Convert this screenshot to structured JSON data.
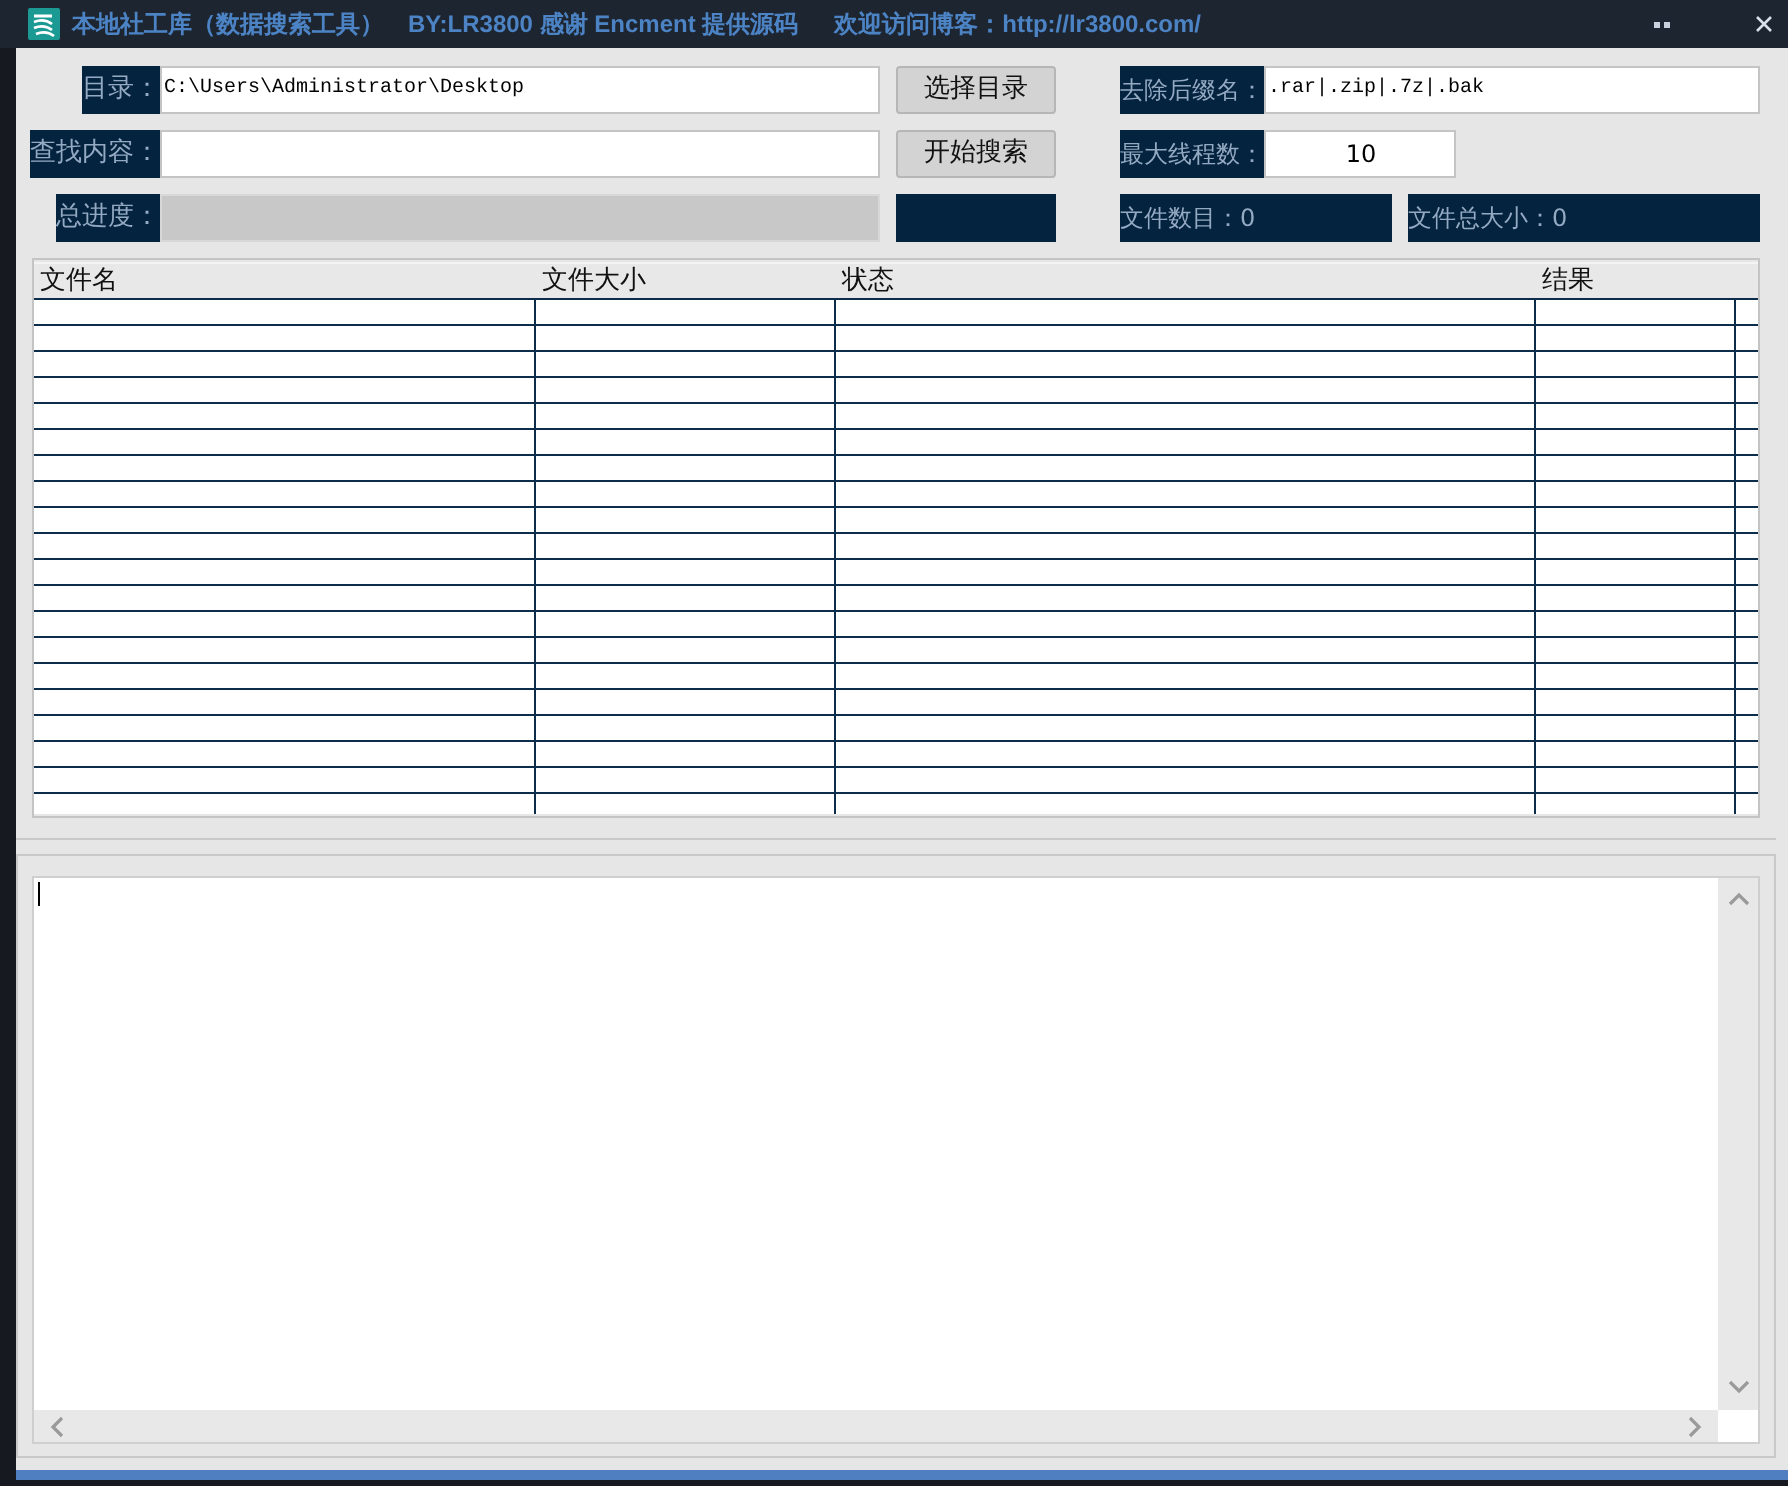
{
  "window": {
    "title": [
      "本地社工库（数据搜索工具）",
      "BY:LR3800 感谢 Encment 提供源码",
      "欢迎访问博客：http://lr3800.com/"
    ]
  },
  "form": {
    "directory": {
      "label": "目录：",
      "value": "C:\\Users\\Administrator\\Desktop"
    },
    "query": {
      "label": "查找内容："
    },
    "progress": {
      "label": "总进度：",
      "level": 0
    },
    "choose_button": "选择目录",
    "search_button": "开始搜索",
    "exclude_extensions": {
      "label": "去除后缀名：",
      "value": ".rar|.zip|.7z|.bak"
    },
    "max_threads": {
      "label": "最大线程数：",
      "value": "10"
    },
    "file_count": "文件数目：0",
    "total_size": "文件总大小：0"
  },
  "table": {
    "columns": [
      "文件名",
      "文件大小",
      "状态",
      "结果"
    ]
  }
}
